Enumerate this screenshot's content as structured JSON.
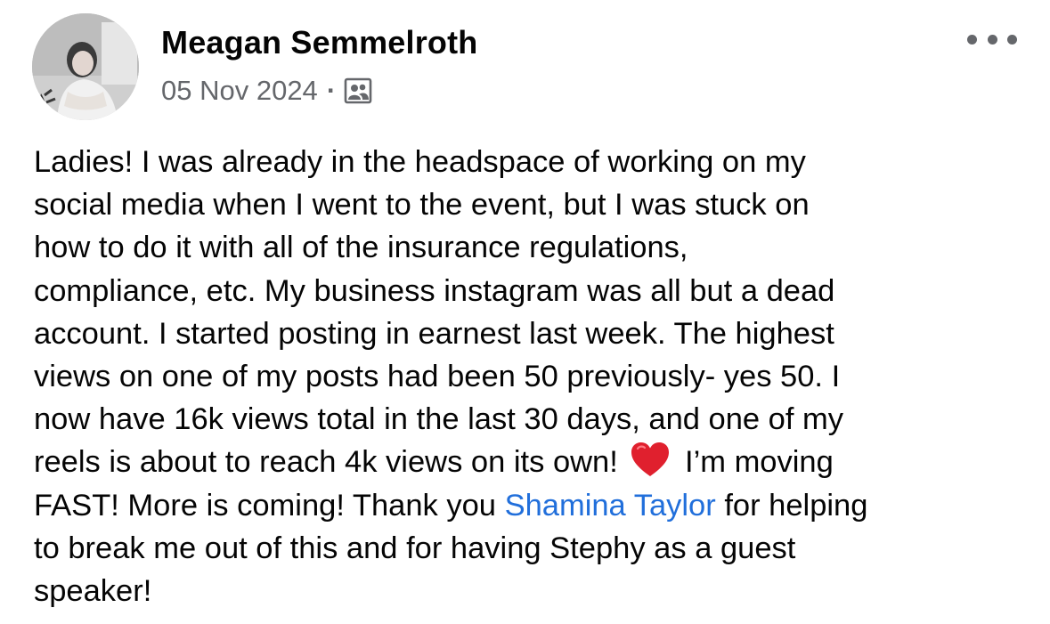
{
  "post": {
    "author": {
      "name": "Meagan Semmelroth",
      "avatar_icon": "profile-photo"
    },
    "date": "05 Nov 2024",
    "separator": "·",
    "privacy_icon": "group-members-icon",
    "more_icon": "more-options-icon",
    "body": {
      "line1": "Ladies! I was already in the headspace of working on my",
      "line2": "social media when I went to the event, but I was stuck on",
      "line3": "how to do it with all of the insurance regulations,",
      "line4": "compliance, etc. My business instagram was all but a dead",
      "line5": "account. I started posting in earnest last week. The highest",
      "line6": "views on one of my posts had been 50 previously- yes 50. I",
      "line7": "now have 16k views total in the last 30 days, and one of my",
      "line8a": "reels is about to reach 4k views on its own! ",
      "line8_emoji": "heart-emoji",
      "line8b": " I’m moving",
      "line9a": "FAST! More is coming! Thank you ",
      "line9_mention": "Shamina Taylor",
      "line9b": " for helping",
      "line10": "to break me out of this and for having Stephy as a guest",
      "line11": "speaker!"
    },
    "colors": {
      "text": "#050505",
      "secondary": "#65676b",
      "mention": "#216fdb",
      "heart": "#e0202e"
    }
  }
}
